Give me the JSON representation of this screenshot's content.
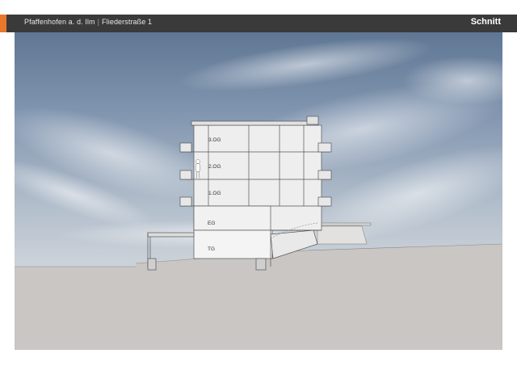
{
  "header": {
    "location": "Pfaffenhofen a. d. Ilm",
    "separator": "|",
    "address": "Fliederstraße 1",
    "section_title": "Schnitt"
  },
  "drawing": {
    "floors": [
      "3.OG",
      "2.OG",
      "1.OG",
      "EG",
      "TG"
    ]
  },
  "colors": {
    "header_bg": "#3a3a3a",
    "accent": "#e8782a",
    "sky_top": "#5f7794",
    "ground": "#c9c6c3"
  }
}
